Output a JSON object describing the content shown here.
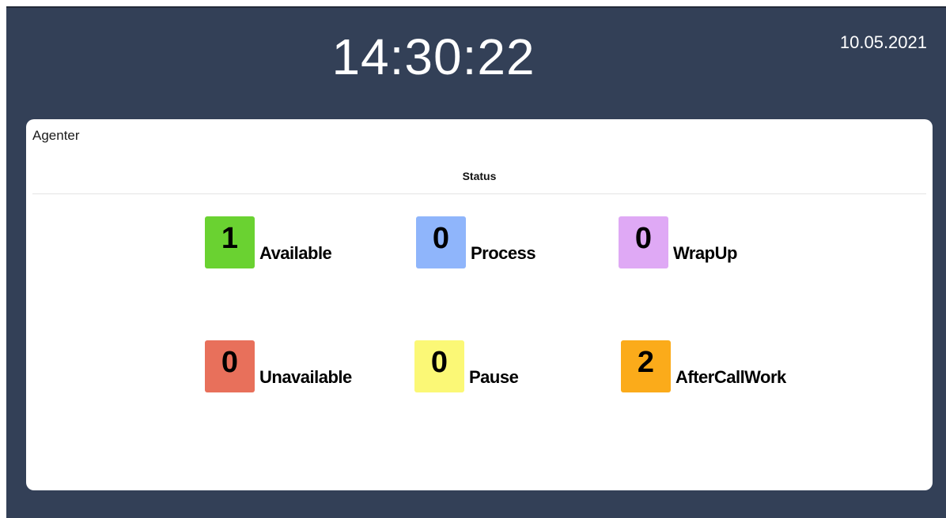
{
  "clock": {
    "time": "14:30:22",
    "date": "10.05.2021"
  },
  "panel": {
    "title": "Agenter",
    "column_header": "Status",
    "statuses": [
      {
        "count": "1",
        "label": "Available",
        "color": "#6ad231"
      },
      {
        "count": "0",
        "label": "Process",
        "color": "#8fb5fb"
      },
      {
        "count": "0",
        "label": "WrapUp",
        "color": "#dfa9f5"
      },
      {
        "count": "0",
        "label": "Unavailable",
        "color": "#e8705b"
      },
      {
        "count": "0",
        "label": "Pause",
        "color": "#fbf876"
      },
      {
        "count": "2",
        "label": "AfterCallWork",
        "color": "#fbab1a"
      }
    ]
  }
}
